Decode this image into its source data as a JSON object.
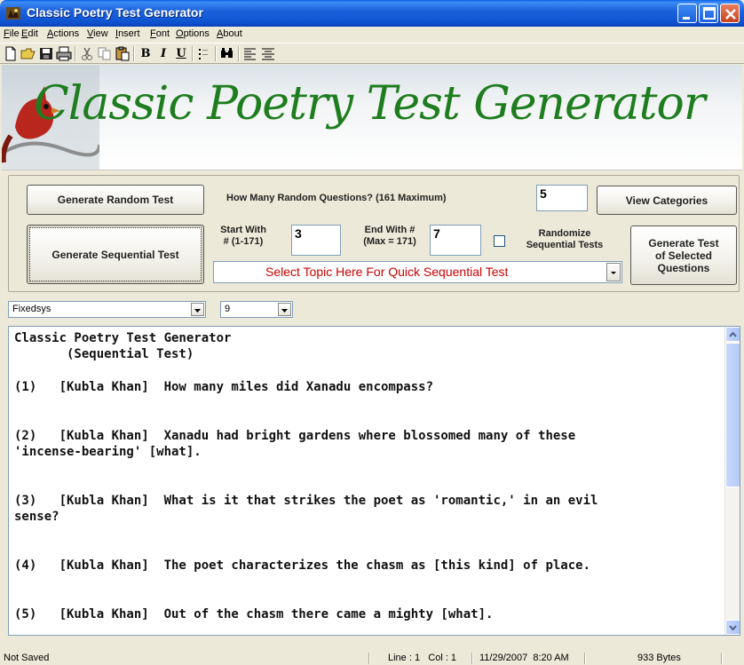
{
  "window": {
    "title": "Classic Poetry Test Generator"
  },
  "menu": [
    "File",
    "Edit",
    "Actions",
    "View",
    "Insert",
    "Font",
    "Options",
    "About"
  ],
  "toolbar_icons": [
    "new-file-icon",
    "open-folder-icon",
    "save-icon",
    "print-icon",
    "cut-icon",
    "copy-icon",
    "paste-icon",
    "bold-icon",
    "italic-icon",
    "underline-icon",
    "bullets-icon",
    "find-icon",
    "align-left-icon",
    "align-center-icon"
  ],
  "toolbar_text": {
    "bold": "B",
    "italic": "I",
    "underline": "U"
  },
  "banner": {
    "title": "Classic Poetry Test Generator"
  },
  "controls": {
    "random_button": "Generate Random Test",
    "random_question_label": "How Many Random Questions? (161 Maximum)",
    "random_count": "5",
    "view_categories": "View Categories",
    "sequential_button": "Generate Sequential Test",
    "start_label_line1": "Start With",
    "start_label_line2": "# (1-171)",
    "start_value": "3",
    "end_label_line1": "End With #",
    "end_label_line2": "(Max = 171)",
    "end_value": "7",
    "randomize_line1": "Randomize",
    "randomize_line2": "Sequential Tests",
    "randomize_checked": false,
    "selected_line1": "Generate Test",
    "selected_line2": "of Selected",
    "selected_line3": "Questions",
    "topic_placeholder": "Select Topic Here For Quick Sequential Test"
  },
  "font_row": {
    "font_name": "Fixedsys",
    "font_size": "9"
  },
  "editor": {
    "lines": [
      "Classic Poetry Test Generator",
      "       (Sequential Test)",
      "",
      "(1)   [Kubla Khan]  How many miles did Xanadu encompass?",
      "",
      "",
      "(2)   [Kubla Khan]  Xanadu had bright gardens where blossomed many of these",
      "'incense-bearing' [what].",
      "",
      "",
      "(3)   [Kubla Khan]  What is it that strikes the poet as 'romantic,' in an evil",
      "sense?",
      "",
      "",
      "(4)   [Kubla Khan]  The poet characterizes the chasm as [this kind] of place.",
      "",
      "",
      "(5)   [Kubla Khan]  Out of the chasm there came a mighty [what]."
    ]
  },
  "status": {
    "save_state": "Not Saved",
    "position": "Line : 1   Col : 1",
    "datetime": "11/29/2007  8:20 AM",
    "size": "933 Bytes"
  },
  "colors": {
    "title_bar": "#0a5ee8",
    "banner_text": "#1e7d1e",
    "topic_text": "#cc0000",
    "face": "#ece9d8"
  }
}
